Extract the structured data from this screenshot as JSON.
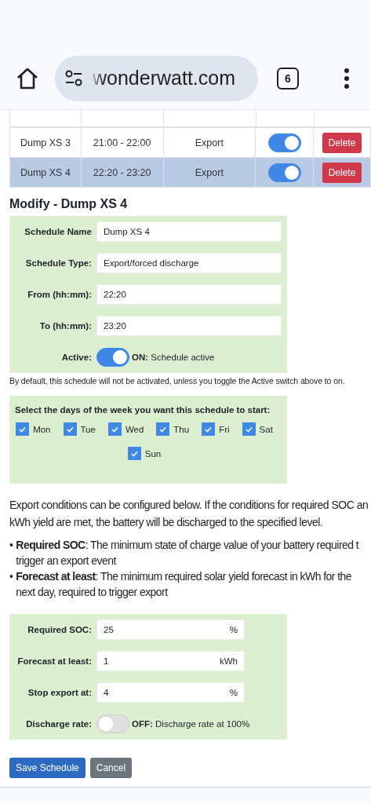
{
  "browser": {
    "url": "wonderwatt.com",
    "tab_count": "6"
  },
  "schedules": [
    {
      "name": "Dump XS 3",
      "time": "21:00 - 22:00",
      "type": "Export",
      "active": true,
      "selected": false,
      "action": "Delete"
    },
    {
      "name": "Dump XS 4",
      "time": "22:20 - 23:20",
      "type": "Export",
      "active": true,
      "selected": true,
      "action": "Delete"
    }
  ],
  "modify": {
    "title": "Modify - Dump XS 4",
    "fields": [
      {
        "label": "Schedule Name",
        "value": "Dump XS 4"
      },
      {
        "label": "Schedule Type:",
        "value": "Export/forced discharge"
      },
      {
        "label": "From (hh:mm):",
        "value": "22:20"
      },
      {
        "label": "To (hh:mm):",
        "value": "23:20"
      }
    ],
    "active": {
      "label": "Active:",
      "on": true,
      "state": "ON:",
      "text": "Schedule active"
    },
    "note": "By default, this schedule will not be activated, unless you toggle the Active switch above to on."
  },
  "days": {
    "title": "Select the days of the week you want this schedule to start:",
    "items": [
      {
        "label": "Mon",
        "checked": true
      },
      {
        "label": "Tue",
        "checked": true
      },
      {
        "label": "Wed",
        "checked": true
      },
      {
        "label": "Thu",
        "checked": true
      },
      {
        "label": "Fri",
        "checked": true
      },
      {
        "label": "Sat",
        "checked": true
      },
      {
        "label": "Sun",
        "checked": true
      }
    ]
  },
  "intro_lines": [
    "Export conditions can be configured below. If the conditions for required SOC an",
    "kWh yield are met, the battery will be discharged to the specified level."
  ],
  "bullets": [
    {
      "marker": "•",
      "lines": [
        "**Required SOC**: The minimum state of charge value of your battery required t",
        "trigger an export event"
      ]
    },
    {
      "marker": "•",
      "lines": [
        "**Forecast at least**: The minimum required solar yield forecast in kWh for the",
        "next day, required to trigger export"
      ]
    }
  ],
  "conditions": [
    {
      "label": "Required SOC:",
      "value": "25",
      "unit": "%"
    },
    {
      "label": "Forecast at least:",
      "value": "1",
      "unit": "kWh"
    },
    {
      "label": "Stop export at:",
      "value": "4",
      "unit": "%"
    }
  ],
  "discharge": {
    "label": "Discharge rate:",
    "on": false,
    "state": "OFF:",
    "text": "Discharge rate at 100%"
  },
  "buttons": [
    {
      "label": "Save Schedule",
      "kind": "primary"
    },
    {
      "label": "Cancel",
      "kind": "secondary"
    }
  ]
}
